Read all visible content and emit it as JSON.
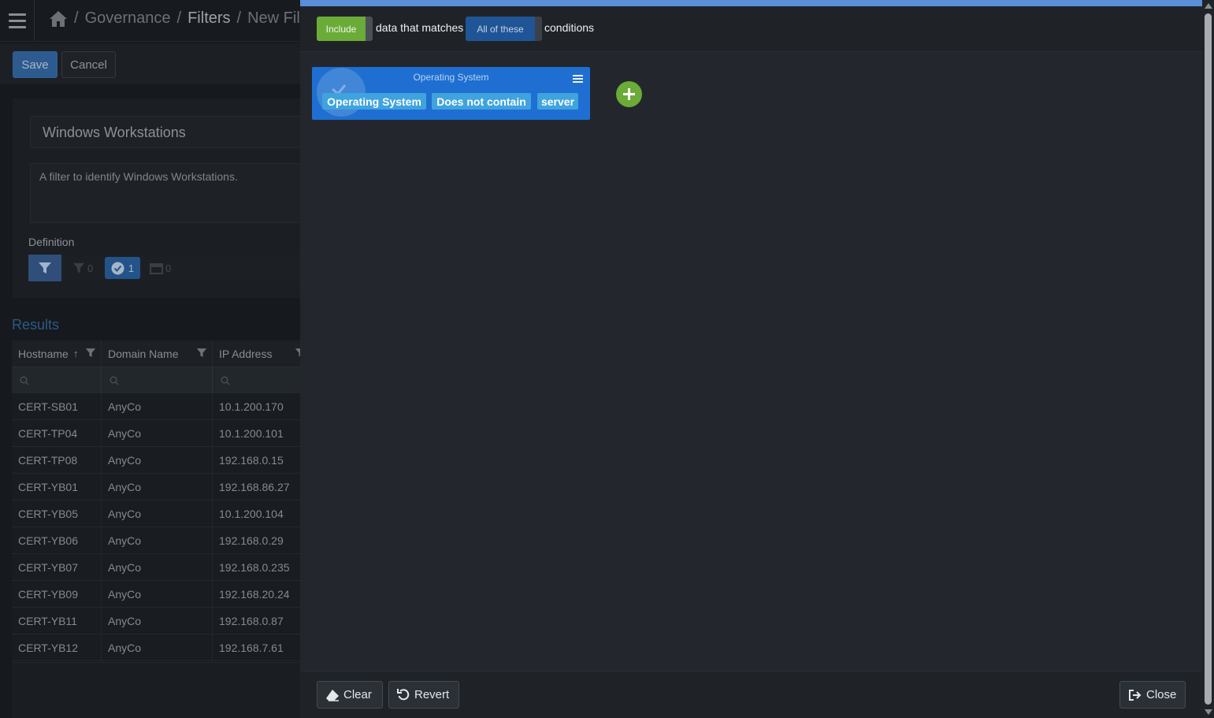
{
  "breadcrumb": {
    "items": [
      "Governance",
      "Filters",
      "New Fil"
    ],
    "separator": "/"
  },
  "toolbar": {
    "save_label": "Save",
    "cancel_label": "Cancel"
  },
  "form": {
    "name_value": "Windows Workstations",
    "description_value": "A filter to identify Windows Workstations.",
    "definition_label": "Definition",
    "counts": {
      "filters": "0",
      "conditions": "1",
      "calendar": "0"
    }
  },
  "results": {
    "title": "Results",
    "columns": [
      "Hostname",
      "Domain Name",
      "IP Address"
    ],
    "rows": [
      [
        "CERT-SB01",
        "AnyCo",
        "10.1.200.170"
      ],
      [
        "CERT-TP04",
        "AnyCo",
        "10.1.200.101"
      ],
      [
        "CERT-TP08",
        "AnyCo",
        "192.168.0.15"
      ],
      [
        "CERT-YB01",
        "AnyCo",
        "192.168.86.27"
      ],
      [
        "CERT-YB05",
        "AnyCo",
        "10.1.200.104"
      ],
      [
        "CERT-YB06",
        "AnyCo",
        "192.168.0.29"
      ],
      [
        "CERT-YB07",
        "AnyCo",
        "192.168.0.235"
      ],
      [
        "CERT-YB09",
        "AnyCo",
        "192.168.20.24"
      ],
      [
        "CERT-YB11",
        "AnyCo",
        "192.168.0.87"
      ],
      [
        "CERT-YB12",
        "AnyCo",
        "192.168.7.61"
      ]
    ]
  },
  "modal": {
    "include_label": "Include",
    "matches_text": "data that matches",
    "all_label": "All of these",
    "conditions_text": "conditions",
    "condition": {
      "title": "Operating System",
      "field": "Operating System",
      "operator": "Does not contain",
      "value": "server"
    },
    "clear_label": "Clear",
    "revert_label": "Revert",
    "close_label": "Close"
  },
  "colors": {
    "accent_blue": "#5b8ed8",
    "include_green": "#6aac37",
    "condition_blue": "#1e6fd1",
    "chip_blue": "#3fa3de"
  }
}
